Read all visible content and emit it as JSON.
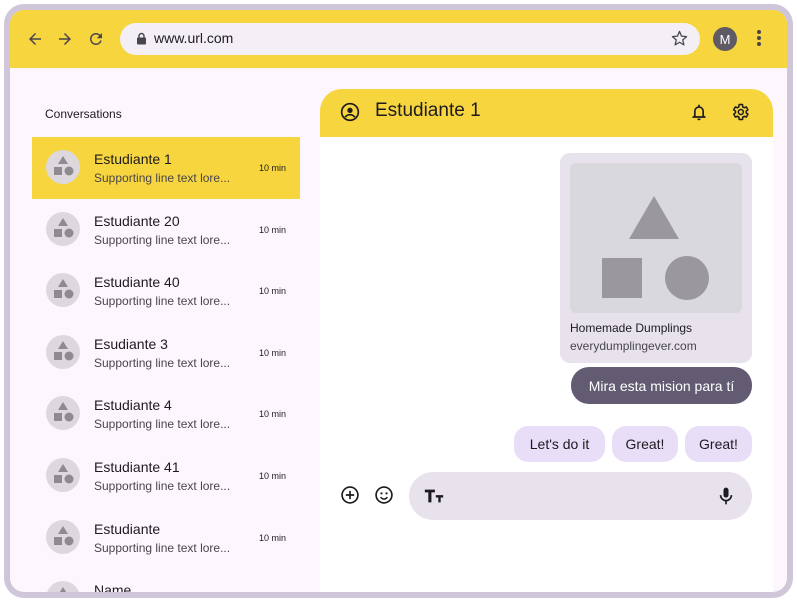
{
  "browser": {
    "url": "www.url.com",
    "profile_initial": "M",
    "accent": "#f7d53e"
  },
  "sidebar": {
    "title": "Conversations",
    "items": [
      {
        "name": "Estudiante 1",
        "preview": "Supporting line text lore...",
        "time": "10 min",
        "active": true
      },
      {
        "name": "Estudiante 20",
        "preview": "Supporting line text lore...",
        "time": "10 min",
        "active": false
      },
      {
        "name": "Estudiante 40",
        "preview": "Supporting line text lore...",
        "time": "10 min",
        "active": false
      },
      {
        "name": "Esudiante 3",
        "preview": "Supporting line text lore...",
        "time": "10 min",
        "active": false
      },
      {
        "name": "Estudiante 4",
        "preview": "Supporting line text lore...",
        "time": "10 min",
        "active": false
      },
      {
        "name": "Estudiante 41",
        "preview": "Supporting line text lore...",
        "time": "10 min",
        "active": false
      },
      {
        "name": "Estudiante",
        "preview": "Supporting line text lore...",
        "time": "10 min",
        "active": false
      },
      {
        "name": "Name",
        "preview": "",
        "time": "",
        "active": false
      }
    ]
  },
  "chat": {
    "title": "Estudiante 1",
    "link_card": {
      "title": "Homemade Dumplings",
      "url": "everydumplingever.com"
    },
    "sent_message": "Mira esta mision para tí",
    "suggestions": [
      "Let's do it",
      "Great!",
      "Great!"
    ],
    "composer_placeholder": ""
  }
}
